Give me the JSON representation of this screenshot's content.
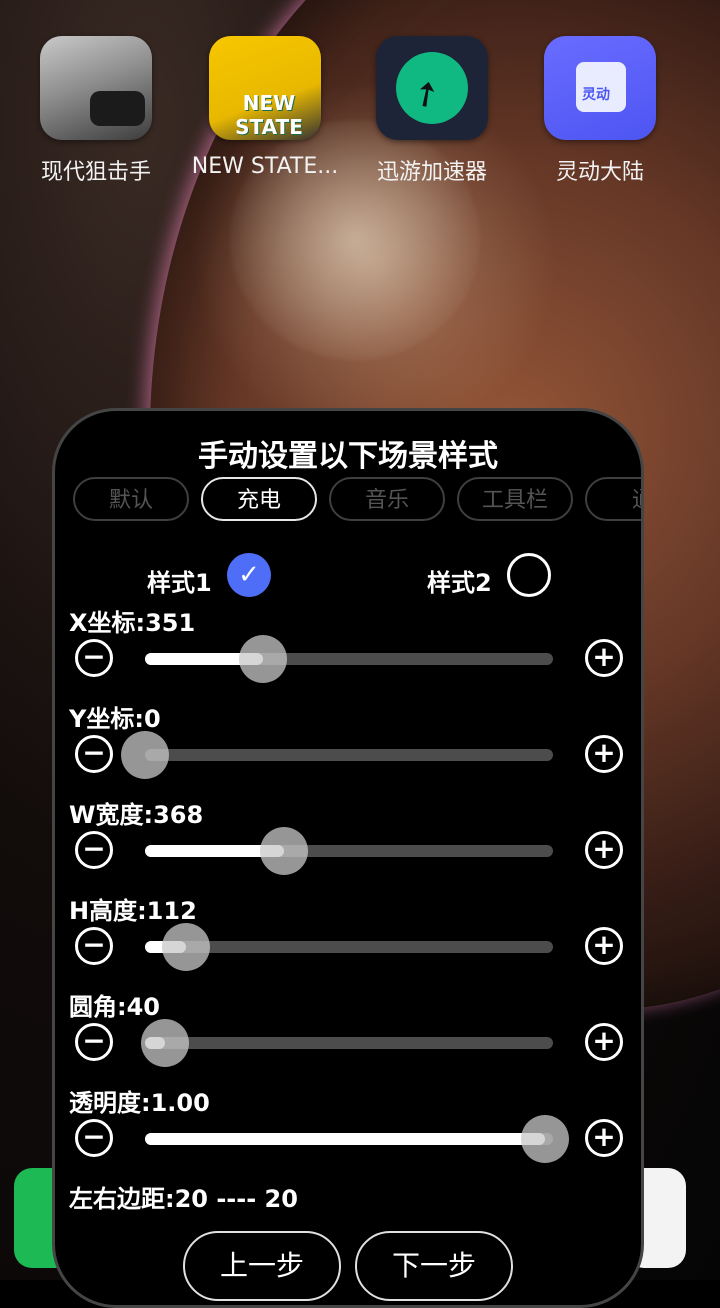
{
  "apps": [
    {
      "label": "现代狙击手",
      "icon": "sniper-game-icon"
    },
    {
      "label": "NEW STATE...",
      "icon": "new-state-game-icon",
      "icon_text": "NEW STATE"
    },
    {
      "label": "迅游加速器",
      "icon": "xunyou-accelerator-icon"
    },
    {
      "label": "灵动大陆",
      "icon": "lingdong-app-icon",
      "icon_text": "灵动"
    }
  ],
  "panel": {
    "title": "手动设置以下场景样式",
    "tabs": [
      {
        "label": "默认",
        "active": false
      },
      {
        "label": "充电",
        "active": true
      },
      {
        "label": "音乐",
        "active": false
      },
      {
        "label": "工具栏",
        "active": false
      },
      {
        "label": "通",
        "active": false
      }
    ],
    "styles": {
      "style1": {
        "label": "样式1",
        "selected": true
      },
      "style2": {
        "label": "样式2",
        "selected": false
      }
    },
    "settings": [
      {
        "key": "x",
        "label": "X坐标:351",
        "fraction": 0.29
      },
      {
        "key": "y",
        "label": "Y坐标:0",
        "fraction": 0.0
      },
      {
        "key": "w",
        "label": "W宽度:368",
        "fraction": 0.34
      },
      {
        "key": "h",
        "label": "H高度:112",
        "fraction": 0.1
      },
      {
        "key": "radius",
        "label": "圆角:40",
        "fraction": 0.05
      },
      {
        "key": "alpha",
        "label": "透明度:1.00",
        "fraction": 0.98
      }
    ],
    "margins": {
      "label": "左右边距:20 ---- 20"
    },
    "buttons": {
      "prev": "上一步",
      "next": "下一步"
    }
  },
  "colors": {
    "accent": "#4f6ef7",
    "track": "#4c4c4c",
    "panel_bg": "#000000"
  }
}
